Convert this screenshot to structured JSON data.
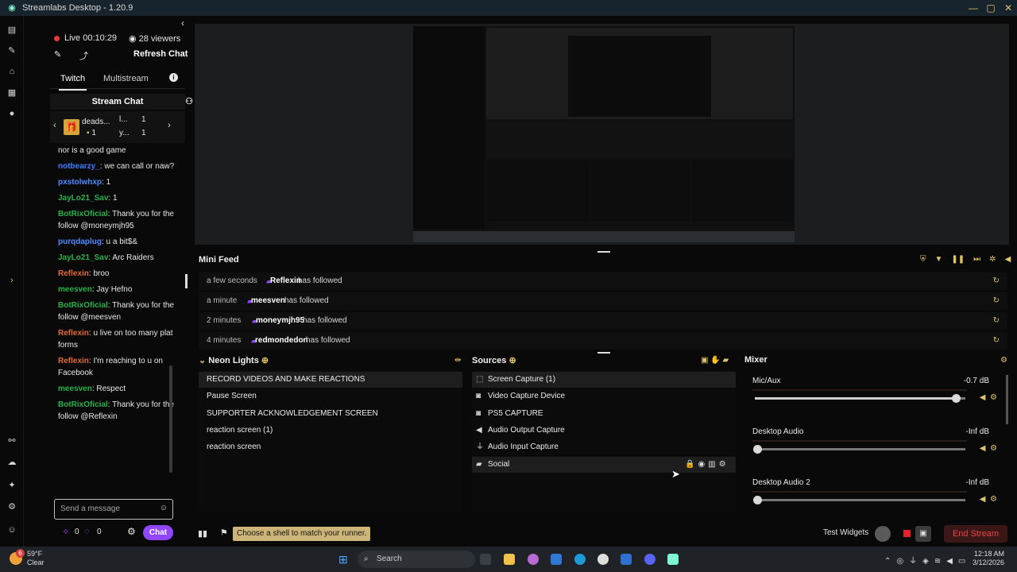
{
  "window": {
    "title": "Streamlabs Desktop - 1.20.9"
  },
  "chat": {
    "live_time": "Live 00:10:29",
    "viewers": "28 viewers",
    "refresh_label": "Refresh Chat",
    "tabs": [
      "Twitch",
      "Multistream"
    ],
    "header": "Stream Chat",
    "gift_user": "deads...",
    "gift_user_count": "1",
    "gift_l_name": "l...",
    "gift_l_count": "1",
    "gift_y_name": "y...",
    "gift_y_count": "1",
    "messages": [
      {
        "user": "",
        "text": "nor is a good game",
        "color": "#ffffff"
      },
      {
        "user": "notbearzy_",
        "text": ": we can call or naw?",
        "color": "#3c7dff"
      },
      {
        "user": "pxstolwhxp",
        "text": ": 1",
        "color": "#4f8bff"
      },
      {
        "user": "JayLo21_Sav",
        "text": ": 1",
        "color": "#27b24a"
      },
      {
        "user": "BotRixOficial",
        "text": ": Thank you for the follow @moneymjh95",
        "color": "#27b24a"
      },
      {
        "user": "purqdaplug",
        "text": ": u a bit$&",
        "color": "#4f8bff"
      },
      {
        "user": "JayLo21_Sav",
        "text": ": Arc Raiders",
        "color": "#27b24a"
      },
      {
        "user": "Reflexin",
        "text": ": broo",
        "color": "#e26b2e"
      },
      {
        "user": "meesven",
        "text": ": Jay Hefno",
        "color": "#27b24a"
      },
      {
        "user": "BotRixOficial",
        "text": ": Thank you for the follow @meesven",
        "color": "#27b24a"
      },
      {
        "user": "Reflexin",
        "text": ": u live on too many plat forms",
        "color": "#e26b2e"
      },
      {
        "user": "Reflexin",
        "text": ": I'm reaching to u on Facebook",
        "color": "#e26b2e"
      },
      {
        "user": "meesven",
        "text": ": Respect",
        "color": "#27b24a"
      },
      {
        "user": "BotRixOficial",
        "text": ": Thank you for the follow @Reflexin",
        "color": "#27b24a"
      }
    ],
    "send_placeholder": "Send a message",
    "points_a": "0",
    "points_b": "0",
    "chat_button": "Chat"
  },
  "minifeed": {
    "title": "Mini Feed",
    "rows": [
      {
        "time": "a few seconds",
        "name": "Reflexin",
        "action": "has followed"
      },
      {
        "time": "a minute",
        "name": "meesven",
        "action": "has followed"
      },
      {
        "time": "2 minutes",
        "name": "moneymjh95",
        "action": "has followed"
      },
      {
        "time": "4 minutes",
        "name": "redmondedon",
        "action": "has followed"
      }
    ]
  },
  "scenes": {
    "title": "Neon Lights",
    "items": [
      "RECORD VIDEOS AND MAKE REACTIONS",
      "Pause Screen",
      "SUPPORTER ACKNOWLEDGEMENT SCREEN",
      "reaction screen (1)",
      "reaction screen"
    ]
  },
  "sources": {
    "title": "Sources",
    "items": [
      "Screen Capture (1)",
      "Video Capture Device",
      "PS5 CAPTURE",
      "Audio Output Capture",
      "Audio Input Capture",
      "Social"
    ]
  },
  "mixer": {
    "title": "Mixer",
    "items": [
      {
        "name": "Mic/Aux",
        "db": "-0.7 dB",
        "level": 0.97
      },
      {
        "name": "Desktop Audio",
        "db": "-Inf dB",
        "level": 0.0
      },
      {
        "name": "Desktop Audio 2",
        "db": "-Inf dB",
        "level": 0.0
      }
    ]
  },
  "bottombar": {
    "tip": "Choose a shell to match your runner.",
    "test_widgets": "Test Widgets",
    "end_stream": "End Stream"
  },
  "taskbar": {
    "weather_temp": "59°F",
    "weather_cond": "Clear",
    "weather_badge": "6",
    "search_label": "Search",
    "time": "12:18 AM",
    "date": "3/12/2026"
  },
  "colors": {
    "accent": "#9146ff",
    "gold": "#e0c46c",
    "end_stream": "#e84646"
  }
}
